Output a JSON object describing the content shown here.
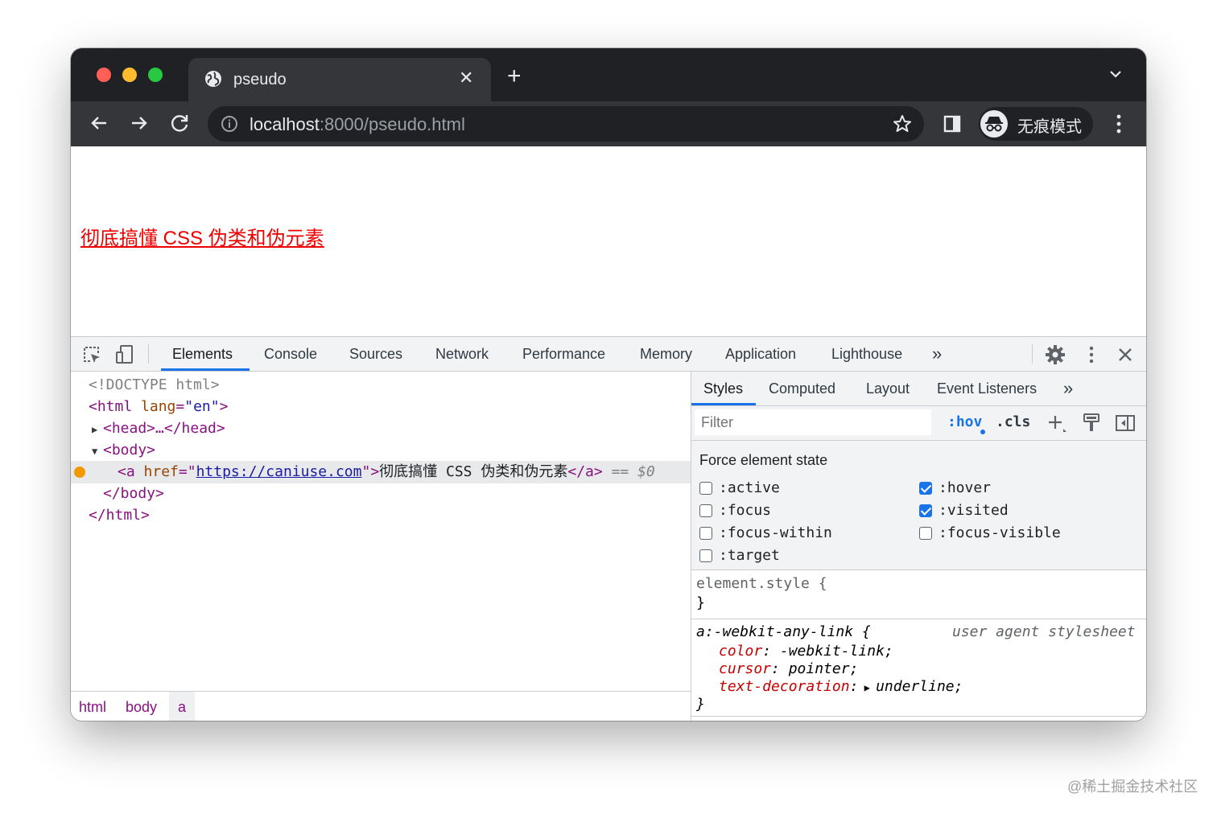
{
  "browser": {
    "tab_title": "pseudo",
    "url_host": "localhost",
    "url_rest": ":8000/pseudo.html",
    "incognito_label": "无痕模式"
  },
  "page": {
    "link_text": "彻底搞懂 CSS 伪类和伪元素"
  },
  "devtools": {
    "tabs": [
      "Elements",
      "Console",
      "Sources",
      "Network",
      "Performance",
      "Memory",
      "Application",
      "Lighthouse"
    ],
    "more": "»",
    "dom": {
      "doctype": "<!DOCTYPE html>",
      "html_open": "<html",
      "html_attr": "lang",
      "html_attr_val": "\"en\"",
      "html_close_bracket": ">",
      "head": "<head>…</head>",
      "body_open": "<body>",
      "a_open": "<a",
      "a_attr": "href",
      "a_href": "https://caniuse.com",
      "a_text": "彻底搞懂 CSS 伪类和伪元素",
      "a_close": "</a>",
      "eq": "== $0",
      "body_close": "</body>",
      "html_close": "</html>"
    },
    "breadcrumbs": [
      "html",
      "body",
      "a"
    ],
    "side_tabs": [
      "Styles",
      "Computed",
      "Layout",
      "Event Listeners"
    ],
    "filter_placeholder": "Filter",
    "hov": ":hov",
    "cls": ".cls",
    "force_title": "Force element state",
    "states": {
      "active": ":active",
      "focus": ":focus",
      "focus_within": ":focus-within",
      "target": ":target",
      "hover": ":hover",
      "visited": ":visited",
      "focus_visible": ":focus-visible"
    },
    "rules": {
      "element_style": "element.style {",
      "close": "}",
      "ua_selector": "a:-webkit-any-link {",
      "ua_source": "user agent stylesheet",
      "p1_name": "color",
      "p1_val": ": -webkit-link;",
      "p2_name": "cursor",
      "p2_val": ": pointer;",
      "p3_name": "text-decoration",
      "p3_colon": ":",
      "p3_val": "underline;"
    }
  },
  "watermark": "@稀土掘金技术社区",
  "colors": {
    "accent": "#1a73e8",
    "link_red": "#ee0000",
    "tag_purple": "#881280"
  }
}
